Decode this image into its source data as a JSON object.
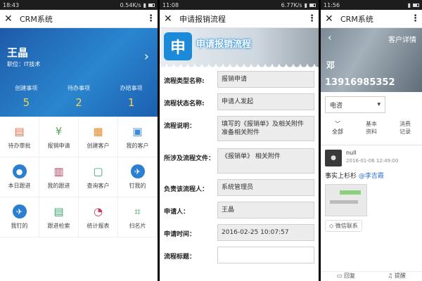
{
  "panel1": {
    "status": {
      "time": "18:43",
      "speed": "0.54K/s"
    },
    "title": "CRM系统",
    "user": {
      "name": "王晶",
      "position": "职位：IT技术"
    },
    "stats": [
      {
        "label": "创建事项",
        "value": "5"
      },
      {
        "label": "待办事项",
        "value": "2"
      },
      {
        "label": "办结事项",
        "value": "1"
      }
    ],
    "grid": [
      {
        "label": "待办审批",
        "icon": "approval-icon"
      },
      {
        "label": "报销申请",
        "icon": "money-bag-icon"
      },
      {
        "label": "创建客户",
        "icon": "building-icon"
      },
      {
        "label": "我的客户",
        "icon": "contact-card-icon"
      },
      {
        "label": "本日跟进",
        "icon": "person-icon"
      },
      {
        "label": "我的跟进",
        "icon": "document-icon"
      },
      {
        "label": "查询客户",
        "icon": "search-person-icon"
      },
      {
        "label": "钉我的",
        "icon": "pin-icon"
      },
      {
        "label": "我钉的",
        "icon": "bird-icon"
      },
      {
        "label": "跟进检索",
        "icon": "search-list-icon"
      },
      {
        "label": "统计报表",
        "icon": "pie-chart-icon"
      },
      {
        "label": "扫名片",
        "icon": "scan-icon"
      }
    ]
  },
  "panel2": {
    "status": {
      "time": "11:08",
      "speed": "6.77K/s"
    },
    "title": "申请报销流程",
    "banner": {
      "logo": "申",
      "text": "申请报销流程"
    },
    "fields": [
      {
        "label": "流程类型名称:",
        "value": "报销申请"
      },
      {
        "label": "流程状态名称:",
        "value": "申请人发起"
      },
      {
        "label": "流程说明：",
        "value": "填写的《报销单》及相关附件 准备相关附件"
      },
      {
        "label": "所涉及流程文件：",
        "value": "《报销单》 相关附件"
      },
      {
        "label": "负责该流程人：",
        "value": "系统管理员"
      },
      {
        "label": "申请人：",
        "value": "王晶"
      },
      {
        "label": "申请时间：",
        "value": "2016-02-25 10:07:57"
      },
      {
        "label": "流程标题：",
        "value": ""
      }
    ]
  },
  "panel3": {
    "status": {
      "time": "11:56"
    },
    "title": "CRM系统",
    "banner": {
      "title": "客户详情",
      "surname": "邓",
      "phone": "13916985352"
    },
    "dropdown": "电咨",
    "tabs": [
      {
        "icon": "﹀",
        "label": "全部"
      },
      {
        "icon": "基本",
        "label": "资料"
      },
      {
        "icon": "消费",
        "label": "记录"
      }
    ],
    "post": {
      "user": "null",
      "time": "2016-01-06 12:49:00",
      "text": "事实上杉杉",
      "mention": "@李吉霞",
      "tag": "微信联系"
    },
    "bottom": {
      "reply": "回复",
      "remind": "提醒"
    }
  },
  "colors": {
    "primary": "#1e5aa9",
    "accent": "#f6d34a",
    "logo": "#1b8ad8"
  }
}
